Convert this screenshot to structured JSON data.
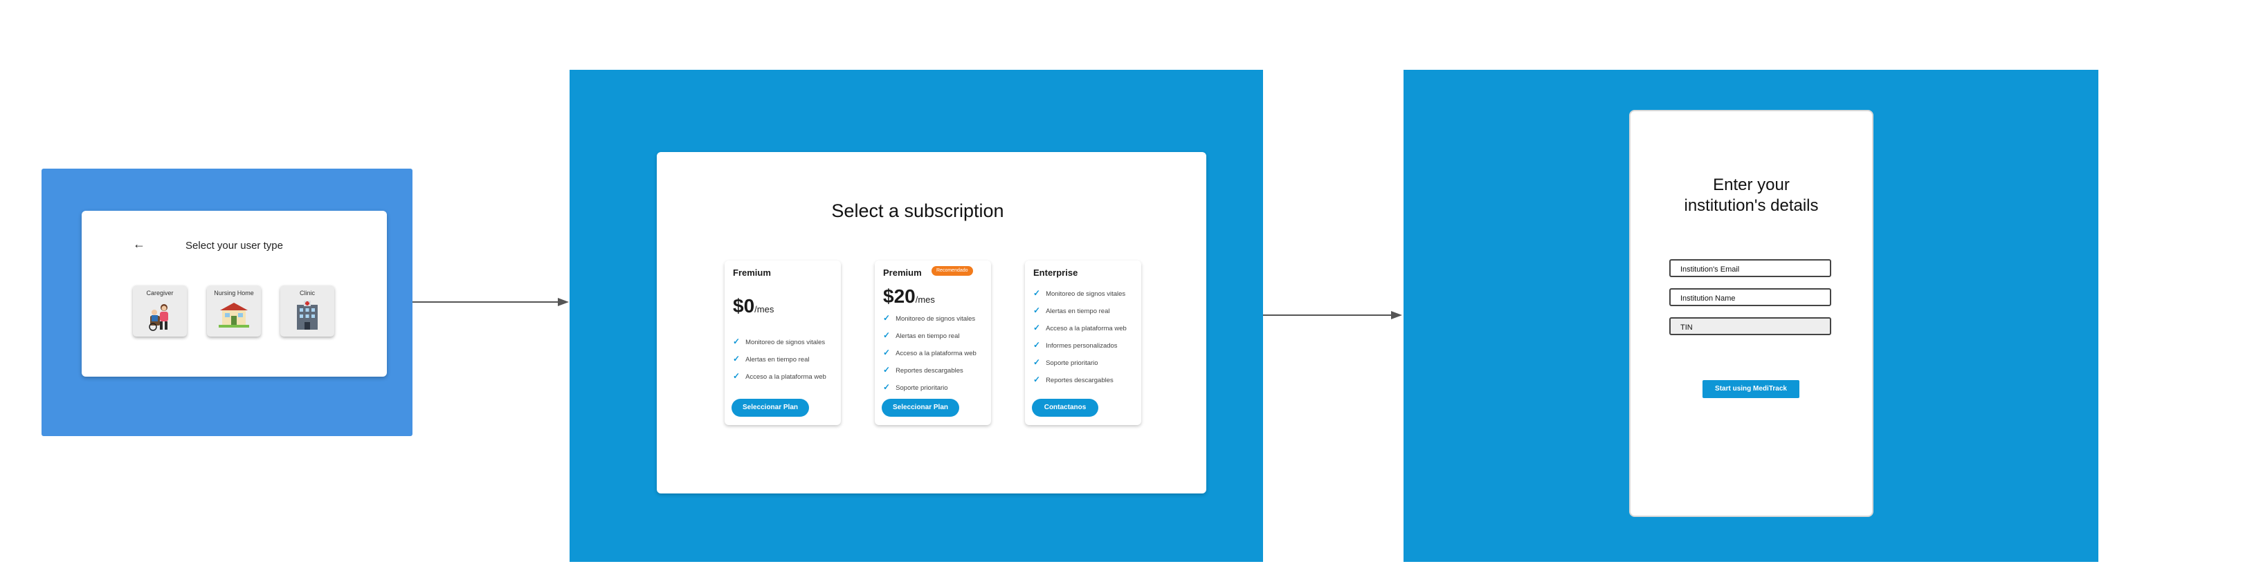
{
  "colors": {
    "screen1_bg": "#4592e2",
    "screen_bg": "#0e96d6",
    "accent": "#0e96d6",
    "badge": "#f27b1c"
  },
  "screen1": {
    "back_icon": "arrow-left-icon",
    "title": "Select your user type",
    "options": [
      {
        "label": "Caregiver",
        "icon": "caregiver-illustration"
      },
      {
        "label": "Nursing Home",
        "icon": "nursing-home-illustration"
      },
      {
        "label": "Clinic",
        "icon": "clinic-illustration"
      }
    ]
  },
  "screen2": {
    "title": "Select a subscription",
    "plans": [
      {
        "name": "Fremium",
        "price": "$0",
        "period": "/mes",
        "features": [
          "Monitoreo de signos vitales",
          "Alertas en tiempo real",
          "Acceso a la plataforma web"
        ],
        "button": "Seleccionar Plan"
      },
      {
        "name": "Premium",
        "badge": "Recomendado",
        "price": "$20",
        "period": "/mes",
        "features": [
          "Monitoreo de signos vitales",
          "Alertas en tiempo real",
          "Acceso a la plataforma web",
          "Reportes descargables",
          "Soporte prioritario"
        ],
        "button": "Seleccionar Plan"
      },
      {
        "name": "Enterprise",
        "features": [
          "Monitoreo de signos vitales",
          "Alertas en tiempo real",
          "Acceso a la plataforma web",
          "Informes personalizados",
          "Soporte prioritario",
          "Reportes descargables"
        ],
        "button": "Contactanos"
      }
    ]
  },
  "screen3": {
    "title_line1": "Enter your",
    "title_line2": "institution's details",
    "email_placeholder": "Institution's Email",
    "name_placeholder": "Institution Name",
    "tin_placeholder": "TIN",
    "submit": "Start using MediTrack"
  }
}
